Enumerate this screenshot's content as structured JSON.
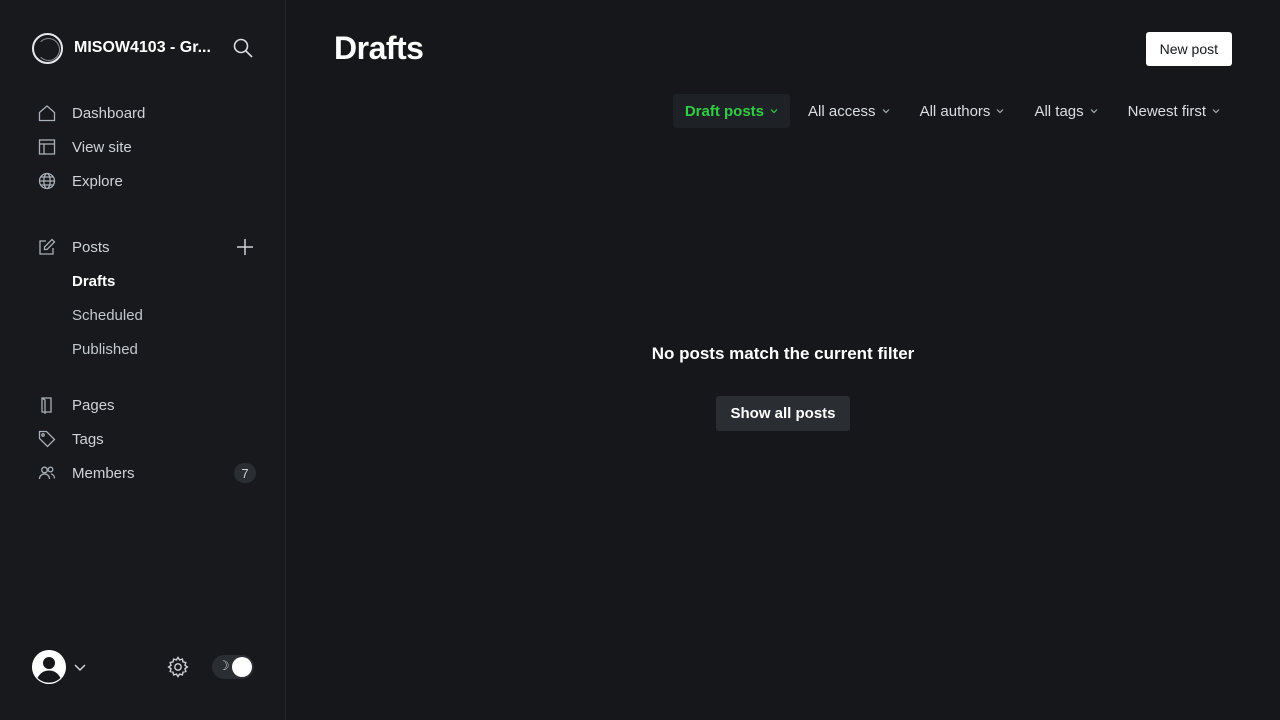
{
  "brand": {
    "title": "MISOW4103 - Gr..."
  },
  "nav": {
    "dashboard": "Dashboard",
    "view_site": "View site",
    "explore": "Explore",
    "posts": "Posts",
    "posts_sub": [
      "Drafts",
      "Scheduled",
      "Published"
    ],
    "pages": "Pages",
    "tags": "Tags",
    "members": "Members",
    "members_count": "7"
  },
  "main": {
    "title": "Drafts",
    "new_post_label": "New post",
    "filters": [
      "Draft posts",
      "All access",
      "All authors",
      "All tags",
      "Newest first"
    ],
    "active_filter": "Draft posts",
    "empty_message": "No posts match the current filter",
    "show_all_label": "Show all posts"
  },
  "colors": {
    "background": "#15171a",
    "accent_green": "#30cf43",
    "text_primary": "#ffffff"
  },
  "icons": [
    "search-icon",
    "home-icon",
    "layout-icon",
    "globe-icon",
    "pencil-square-icon",
    "plus-icon",
    "page-icon",
    "tag-icon",
    "members-icon",
    "user-avatar-icon",
    "chevron-down-icon",
    "gear-icon",
    "moon-icon"
  ]
}
